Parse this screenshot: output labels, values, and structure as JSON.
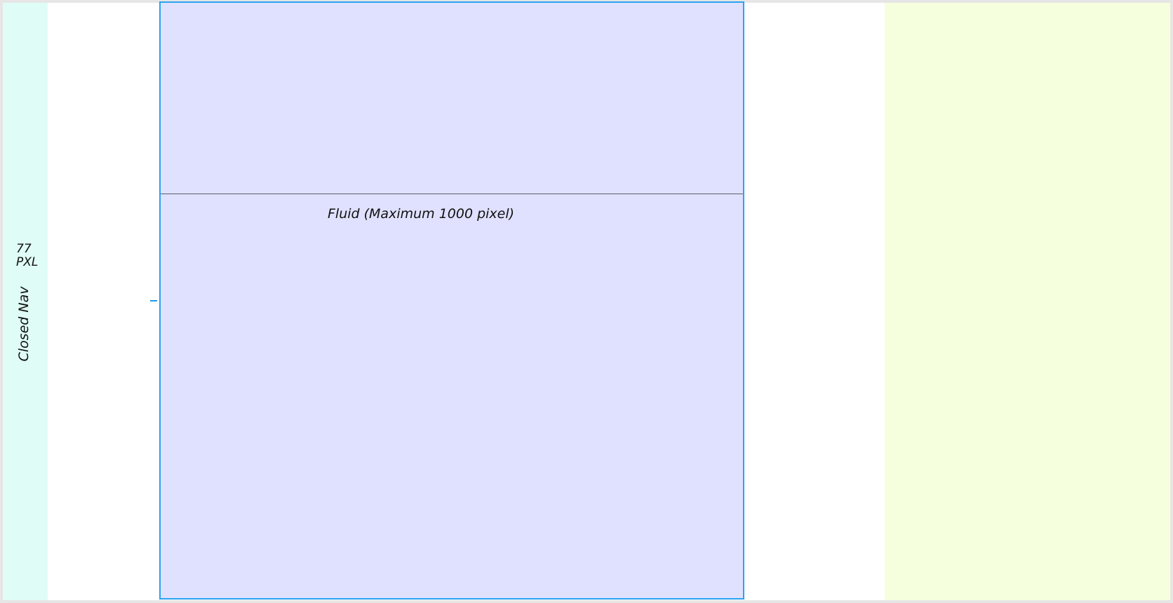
{
  "closed_nav": {
    "size_label": "77 PXL",
    "title": "Closed Nav",
    "color": "#dffdf6"
  },
  "fluid_column": {
    "label": "Fluid (Maximum 1000 pixel)",
    "fill_color": "#dfe1ff",
    "border_color": "#2aa3f2"
  },
  "right_panel": {
    "color": "#f5ffdd"
  },
  "accent_color": "#1e9be8"
}
